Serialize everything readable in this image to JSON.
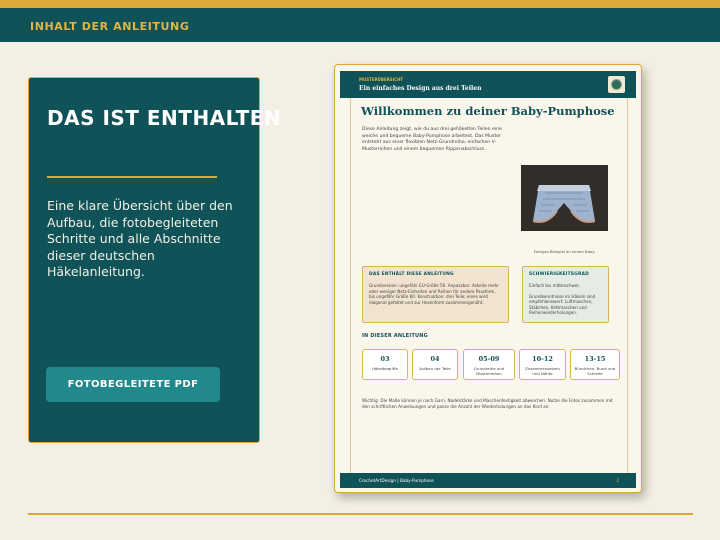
{
  "header": {
    "title": "INHALT DER ANLEITUNG"
  },
  "panel": {
    "heading": "DAS IST ENTHALTEN",
    "body": "Eine klare Übersicht über den Aufbau, die fotobegleiteten Schritte und alle Abschnitte dieser deutschen Häkelanleitung.",
    "button_label": "FOTOBEGLEITETE PDF"
  },
  "document": {
    "kicker": "MUSTERÜBERSICHT",
    "subtitle": "Ein einfaches Design aus drei Teilen",
    "title": "Willkommen zu deiner Baby-Pumphose",
    "intro": "Diese Anleitung zeigt, wie du aus drei gehäkelten Teilen eine weiche und bequeme Baby-Pumphose arbeitest. Das Muster entsteht aus einer flexiblen Netz-Grundreihe, einfachen V-Musterreihen und einem bequemen Rippenabschluss.",
    "photo_caption": "Fertiges Beispiel an einem Baby.",
    "box1": {
      "title": "DAS ENTHÄLT DIESE ANLEITUNG",
      "text": "Grundversion: ungefähr EU-Größe 56. Anpassbar: Arbeite mehr oder weniger Netz-Einheiten und Reihen für andere Passform, bis ungefähr Größe 80. Konstruktion: drei Teile; eines wird diagonal gefaltet und zur Hosenform zusammengenäht."
    },
    "box2": {
      "title": "SCHWIERIGKEITSGRAD",
      "text1": "Einfach bis mittelschwer.",
      "text2": "Grundkenntnisse im Häkeln sind empfehlenswert: Luftmaschen, Stäbchen, Kettmaschen und Reihenwiederholungen."
    },
    "section_title": "IN DIESER ANLEITUNG",
    "tiles": [
      {
        "num": "03",
        "label": "Häkelbegriffe"
      },
      {
        "num": "04",
        "label": "Aufbau der Teile"
      },
      {
        "num": "05-09",
        "label": "Grundreihe und Musterreihen"
      },
      {
        "num": "10-12",
        "label": "Zusammensetzen und Nähte"
      },
      {
        "num": "13-15",
        "label": "Bündchen, Bund und Schleife"
      }
    ],
    "note": "Wichtig: Die Maße können je nach Garn, Nadelstärke und Maschenfestigkeit abweichen. Nutze die Fotos zusammen mit den schriftlichen Anweisungen und passe die Anzahl der Wiederholungen an das Kind an.",
    "footer_left": "CrochetArtDesign  |  Baby-Pumphose",
    "footer_right": "2"
  }
}
